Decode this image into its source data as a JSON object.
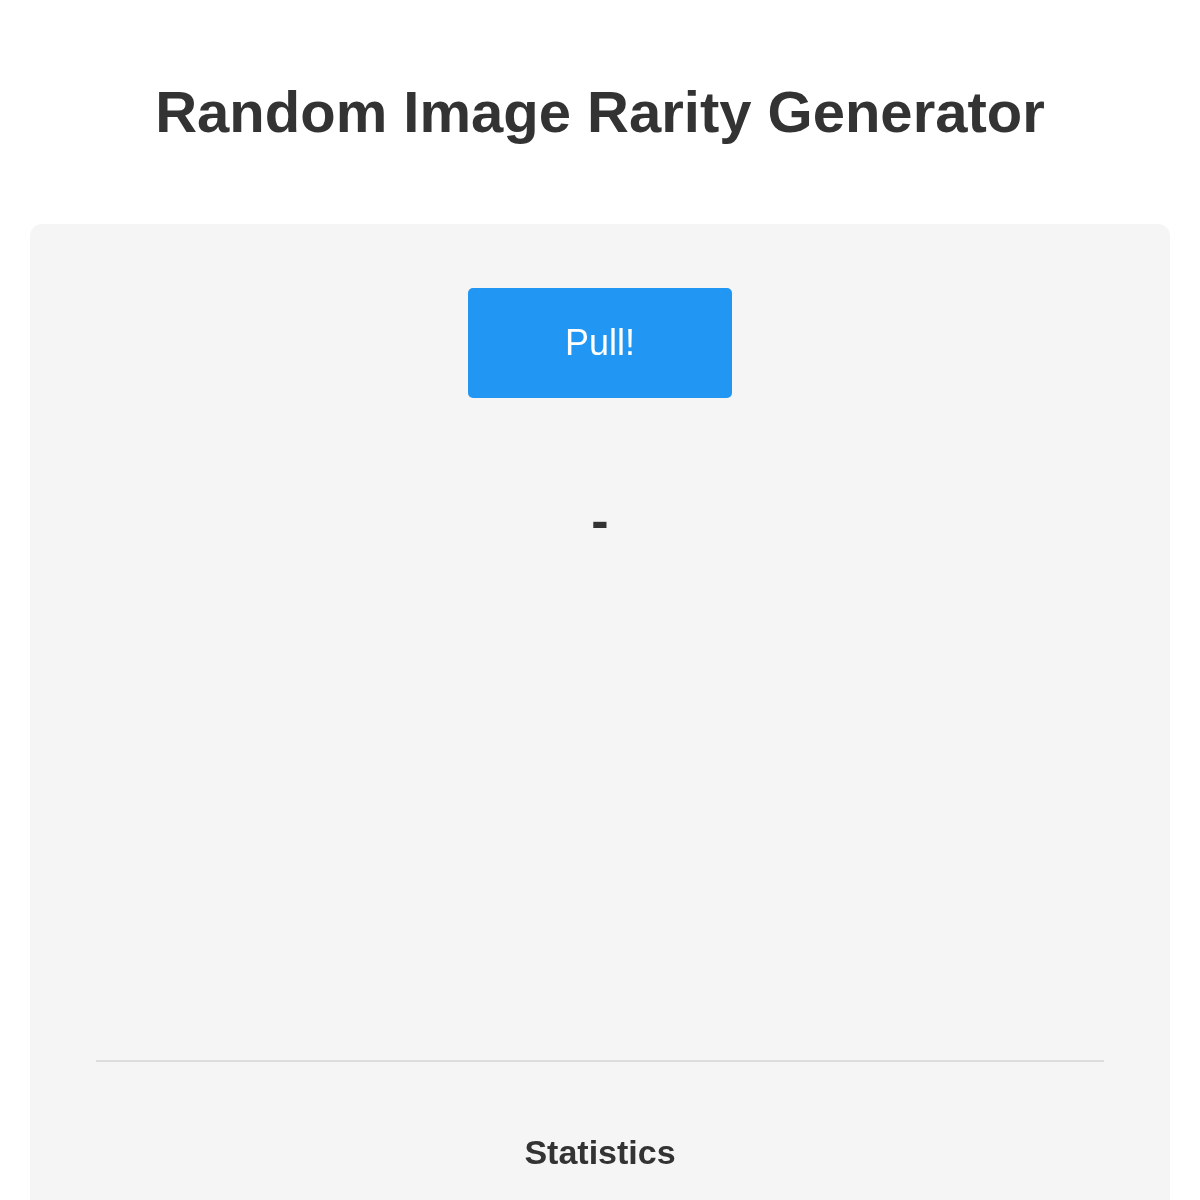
{
  "title": "Random Image Rarity Generator",
  "pull_button": {
    "label": "Pull!"
  },
  "result": "-",
  "statistics": {
    "heading": "Statistics"
  }
}
